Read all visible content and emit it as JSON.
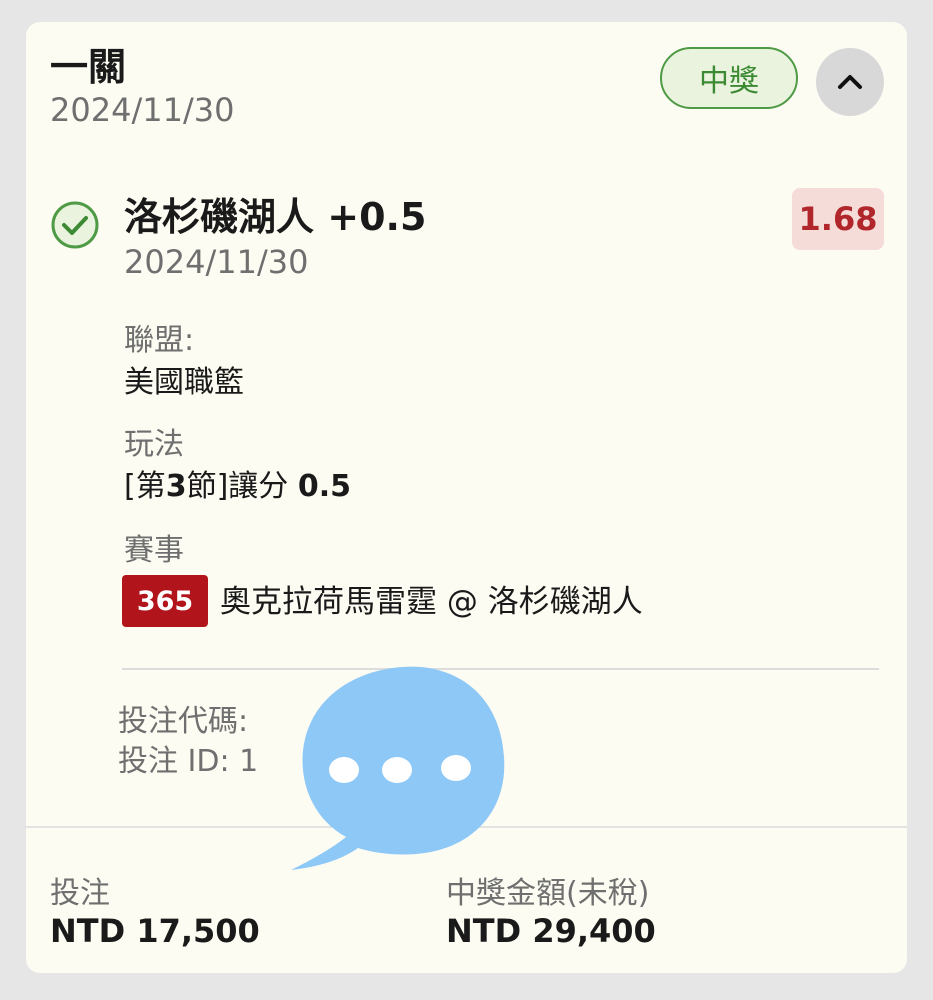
{
  "header": {
    "title": "一關",
    "date": "2024/11/30",
    "status": "中獎"
  },
  "selection": {
    "name": "洛杉磯湖人 +0.5",
    "date": "2024/11/30",
    "odds": "1.68"
  },
  "details": {
    "league_label": "聯盟:",
    "league_value": "美國職籃",
    "play_label": "玩法",
    "play_value_prefix": "[第",
    "play_value_period": "3",
    "play_value_mid": "節]讓分 ",
    "play_value_line": "0.5",
    "event_label": "賽事",
    "event_badge": "365",
    "event_teams": "奧克拉荷馬雷霆 @ 洛杉磯湖人"
  },
  "meta": {
    "bet_code_label": "投注代碼:",
    "bet_id_label": "投注 ID: 1"
  },
  "footer": {
    "stake_label": "投注",
    "stake_value": "NTD 17,500",
    "payout_label": "中獎金額(未稅)",
    "payout_value": "NTD 29,400"
  },
  "icons": {
    "collapse": "chevron-up-icon",
    "won": "check-circle-icon",
    "overlay": "chat-bubble-icon"
  },
  "colors": {
    "card_bg": "#fdfcf3",
    "win_green": "#4e9a45",
    "odds_red": "#b0262a",
    "badge_red": "#b1141a",
    "overlay_blue": "#8ec8f6"
  }
}
